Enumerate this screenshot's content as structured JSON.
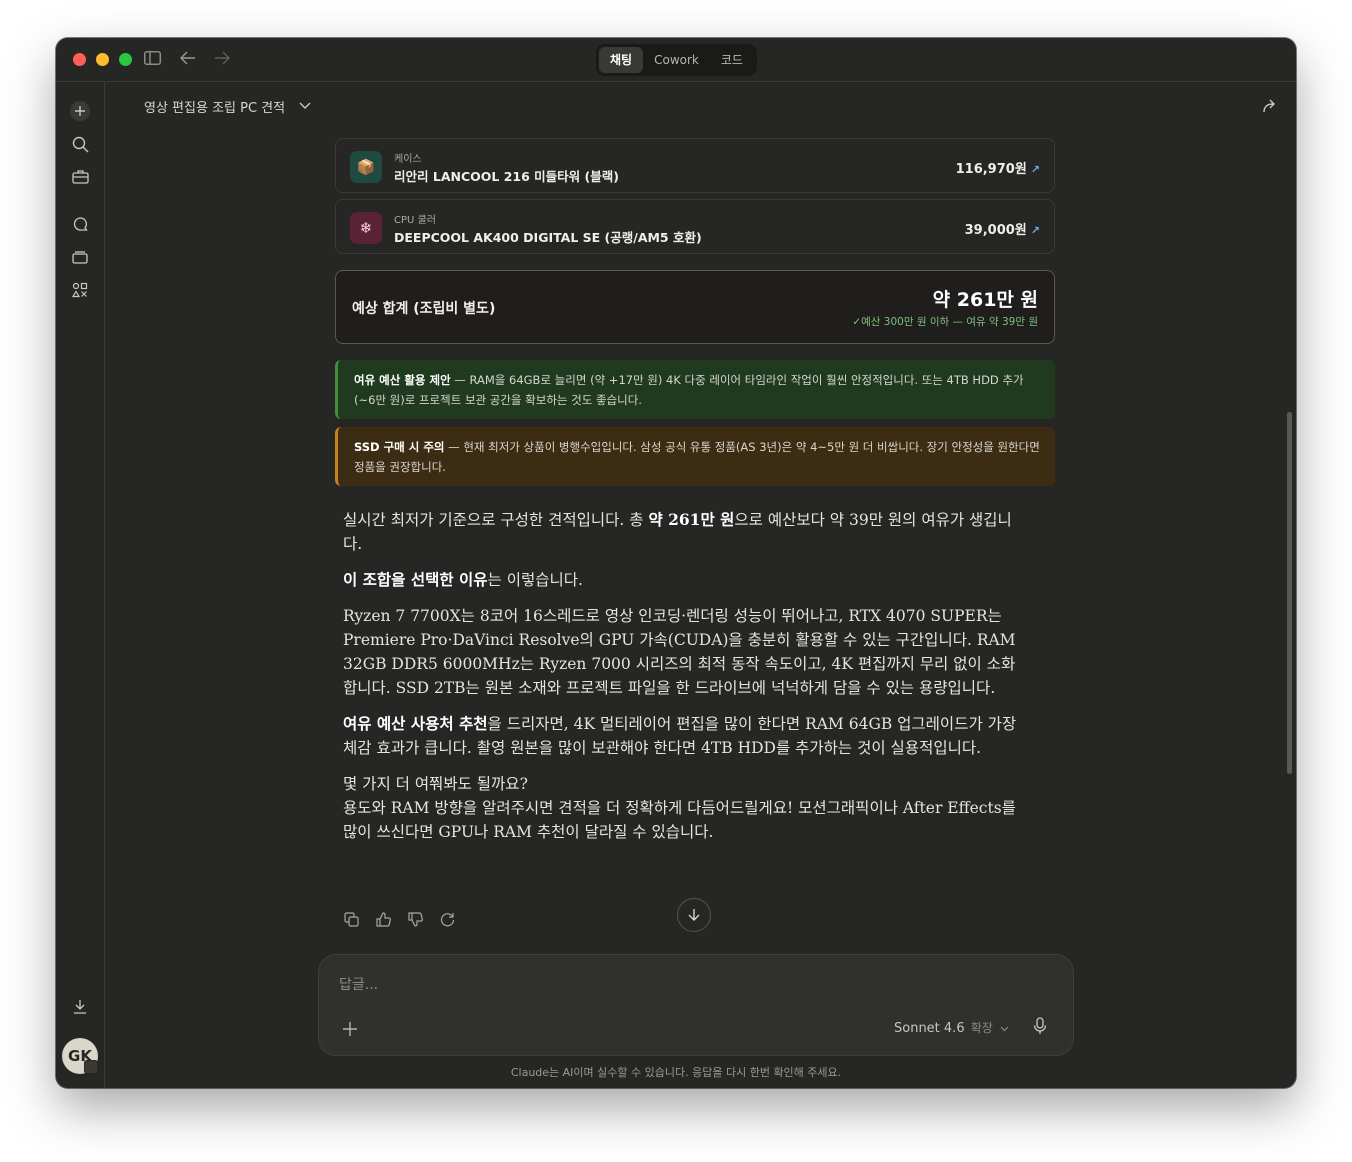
{
  "window": {
    "mode_tabs": [
      {
        "label": "채팅",
        "active": true
      },
      {
        "label": "Cowork",
        "active": false
      },
      {
        "label": "코드",
        "active": false
      }
    ]
  },
  "header": {
    "chat_title": "영상 편집용 조립 PC 견적"
  },
  "parts": [
    {
      "category": "케이스",
      "name": "리안리 LANCOOL 216 미들타워 (블랙)",
      "price": "116,970원",
      "icon": "package-icon",
      "icon_bg": "#1f4a3f"
    },
    {
      "category": "CPU 쿨러",
      "name": "DEEPCOOL AK400 DIGITAL SE (공랭/AM5 호환)",
      "price": "39,000원",
      "icon": "snowflake-icon",
      "icon_bg": "#5a2236"
    }
  ],
  "total": {
    "label": "예상 합계 (조립비 별도)",
    "value": "약 261만 원",
    "note": "✓예산 300만 원 이하 — 여유 약 39만 원"
  },
  "notices": {
    "green": {
      "title": "여유 예산 활용 제안",
      "body": " — RAM을 64GB로 늘리면 (약 +17만 원) 4K 다중 레이어 타임라인 작업이 훨씬 안정적입니다. 또는 4TB HDD 추가(~6만 원)로 프로젝트 보관 공간을 확보하는 것도 좋습니다."
    },
    "orange": {
      "title": "SSD 구매 시 주의",
      "body": " — 현재 최저가 상품이 병행수입입니다. 삼성 공식 유통 정품(AS 3년)은 약 4~5만 원 더 비쌉니다. 장기 안정성을 원한다면 정품을 권장합니다."
    }
  },
  "answer": {
    "p1_pre": "실시간 최저가 기준으로 구성한 견적입니다. 총 ",
    "p1_bold": "약 261만 원",
    "p1_post": "으로 예산보다 약 39만 원의 여유가 생깁니다.",
    "p2_bold": "이 조합을 선택한 이유",
    "p2_post": "는 이렇습니다.",
    "p3": "Ryzen 7 7700X는 8코어 16스레드로 영상 인코딩·렌더링 성능이 뛰어나고, RTX 4070 SUPER는 Premiere Pro·DaVinci Resolve의 GPU 가속(CUDA)을 충분히 활용할 수 있는 구간입니다. RAM 32GB DDR5 6000MHz는 Ryzen 7000 시리즈의 최적 동작 속도이고, 4K 편집까지 무리 없이 소화합니다. SSD 2TB는 원본 소재와 프로젝트 파일을 한 드라이브에 넉넉하게 담을 수 있는 용량입니다.",
    "p4_bold": "여유 예산 사용처 추천",
    "p4_post": "을 드리자면, 4K 멀티레이어 편집을 많이 한다면 RAM 64GB 업그레이드가 가장 체감 효과가 큽니다. 촬영 원본을 많이 보관해야 한다면 4TB HDD를 추가하는 것이 실용적입니다.",
    "p5_line1": "몇 가지 더 여쭤봐도 될까요?",
    "p5_line2": "용도와 RAM 방향을 알려주시면 견적을 더 정확하게 다듬어드릴게요! 모션그래픽이나 After Effects를 많이 쓰신다면 GPU나 RAM 추천이 달라질 수 있습니다."
  },
  "composer": {
    "placeholder": "답글...",
    "model": "Sonnet 4.6",
    "model_mode": "확장"
  },
  "footer": {
    "disclaimer": "Claude는 AI이며 실수할 수 있습니다. 응답을 다시 한번 확인해 주세요."
  },
  "user": {
    "initials": "GK"
  }
}
